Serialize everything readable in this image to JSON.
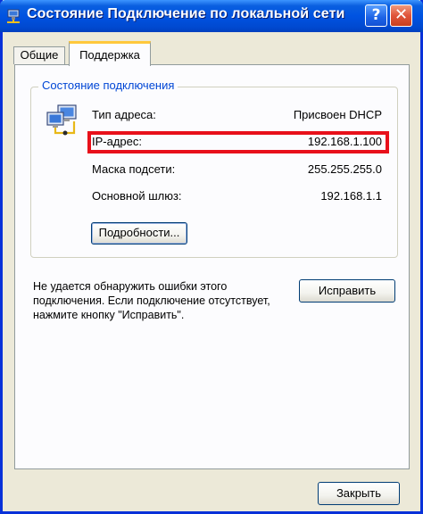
{
  "window": {
    "title": "Состояние Подключение по локальной сети",
    "help_label": "?",
    "close_label": "✕"
  },
  "tabs": [
    {
      "label": "Общие"
    },
    {
      "label": "Поддержка",
      "selected": true
    }
  ],
  "connection_status": {
    "group_label": "Состояние подключения",
    "rows": [
      {
        "label": "Тип адреса:",
        "value": "Присвоен DHCP"
      },
      {
        "label": "IP-адрес:",
        "value": "192.168.1.100"
      },
      {
        "label": "Маска подсети:",
        "value": "255.255.255.0"
      },
      {
        "label": "Основной шлюз:",
        "value": "192.168.1.1"
      }
    ],
    "details_button": "Подробности..."
  },
  "repair": {
    "text": "Не удается обнаружить ошибки этого подключения. Если подключение отсутствует, нажмите кнопку \"Исправить\".",
    "button": "Исправить"
  },
  "footer": {
    "close_button": "Закрыть"
  },
  "colors": {
    "titlebar": "#0053e1",
    "group_label": "#0046d5",
    "highlight": "#e8101a",
    "selected_tab_accent": "#ffc83c"
  },
  "icons": {
    "title": "network-connection-icon",
    "status": "network-computers-icon"
  }
}
